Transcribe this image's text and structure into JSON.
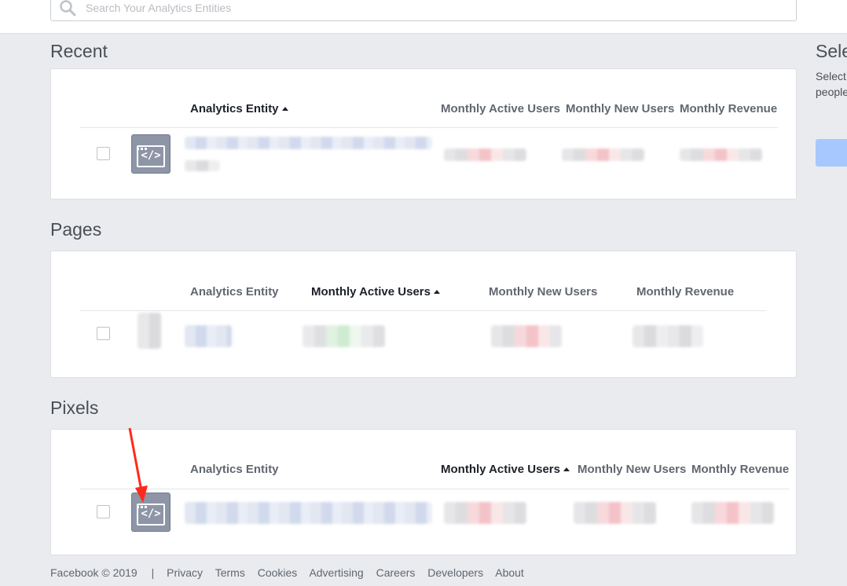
{
  "search": {
    "placeholder": "Search Your Analytics Entities"
  },
  "sections": {
    "recent": {
      "title": "Recent",
      "columns": [
        "Analytics Entity",
        "Monthly Active Users",
        "Monthly New Users",
        "Monthly Revenue"
      ],
      "sorted_column": "Analytics Entity"
    },
    "pages": {
      "title": "Pages",
      "columns": [
        "Analytics Entity",
        "Monthly Active Users",
        "Monthly New Users",
        "Monthly Revenue"
      ],
      "sorted_column": "Monthly Active Users"
    },
    "pixels": {
      "title": "Pixels",
      "columns": [
        "Analytics Entity",
        "Monthly Active Users",
        "Monthly New Users",
        "Monthly Revenue"
      ],
      "sorted_column": "Monthly Active Users"
    }
  },
  "side_panel": {
    "title": "Sele",
    "line1": "Select",
    "line2": "people"
  },
  "footer": {
    "copyright": "Facebook © 2019",
    "separator": "|",
    "links": [
      "Privacy",
      "Terms",
      "Cookies",
      "Advertising",
      "Careers",
      "Developers",
      "About"
    ]
  },
  "icons": {
    "search": "search-icon",
    "entity": "code-window-icon",
    "sort": "sort-ascending-icon",
    "annotation": "red-arrow-annotation"
  },
  "colors": {
    "page_bg": "#e9ebee",
    "accent_button": "#a6c8ff",
    "annotation_red": "#ff2a1a",
    "icon_bg": "#8d95a7"
  }
}
